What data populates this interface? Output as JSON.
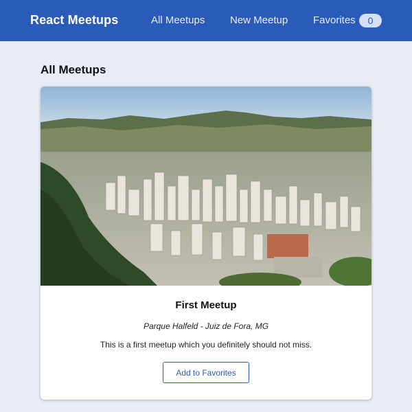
{
  "header": {
    "logo": "React Meetups",
    "nav": {
      "all_meetups": "All Meetups",
      "new_meetup": "New Meetup",
      "favorites": "Favorites",
      "favorites_count": "0"
    }
  },
  "main": {
    "title": "All Meetups",
    "meetups": [
      {
        "title": "First Meetup",
        "address": "Parque Halfeld - Juiz de Fora, MG",
        "description": "This is a first meetup which you definitely should not miss.",
        "button_label": "Add to Favorites"
      }
    ]
  },
  "colors": {
    "header_bg": "#2a5bb8",
    "page_bg": "#e8ecf5",
    "accent": "#2a5bb8"
  }
}
